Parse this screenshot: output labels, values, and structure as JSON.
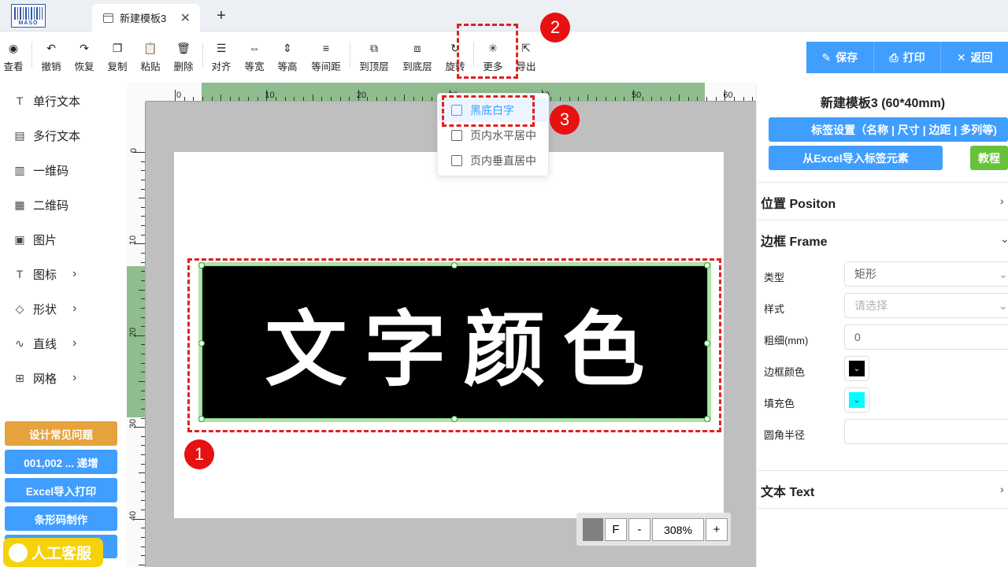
{
  "app": {
    "logo_text": "MASO"
  },
  "tabs": {
    "active_label": "新建模板3",
    "close_glyph": "✕",
    "new_glyph": "+"
  },
  "toolbar": [
    {
      "label": "查看",
      "icon": "eye-icon",
      "glyph": "◉"
    },
    {
      "label": "撤销",
      "icon": "undo-icon",
      "glyph": "↶"
    },
    {
      "label": "恢复",
      "icon": "redo-icon",
      "glyph": "↷"
    },
    {
      "label": "复制",
      "icon": "copy-icon",
      "glyph": "❐"
    },
    {
      "label": "粘贴",
      "icon": "paste-icon",
      "glyph": "📋"
    },
    {
      "label": "删除",
      "icon": "trash-icon",
      "glyph": "🗑"
    },
    {
      "label": "对齐",
      "icon": "align-icon",
      "glyph": "☰"
    },
    {
      "label": "等宽",
      "icon": "equal-width-icon",
      "glyph": "⇔"
    },
    {
      "label": "等高",
      "icon": "equal-height-icon",
      "glyph": "⇕"
    },
    {
      "label": "等间距",
      "icon": "equal-spacing-icon",
      "glyph": "≡"
    },
    {
      "label": "到顶层",
      "icon": "bring-to-front-icon",
      "glyph": "⧉"
    },
    {
      "label": "到底层",
      "icon": "send-to-back-icon",
      "glyph": "⧈"
    },
    {
      "label": "旋转",
      "icon": "rotate-icon",
      "glyph": "↻"
    },
    {
      "label": "更多",
      "icon": "more-icon",
      "glyph": "✳"
    },
    {
      "label": "导出",
      "icon": "export-icon",
      "glyph": "⇱"
    }
  ],
  "actions": {
    "save": "保存",
    "print": "打印",
    "back": "返回"
  },
  "sidebar": {
    "items": [
      {
        "label": "单行文本",
        "glyph": "T",
        "icon": "single-line-text-icon"
      },
      {
        "label": "多行文本",
        "glyph": "▤",
        "icon": "multi-line-text-icon"
      },
      {
        "label": "一维码",
        "glyph": "▥",
        "icon": "barcode-icon"
      },
      {
        "label": "二维码",
        "glyph": "▦",
        "icon": "qrcode-icon"
      },
      {
        "label": "图片",
        "glyph": "▣",
        "icon": "image-icon"
      },
      {
        "label": "图标",
        "glyph": "T",
        "icon": "icon-library-icon",
        "arrow": "›"
      },
      {
        "label": "形状",
        "glyph": "◇",
        "icon": "shape-icon",
        "arrow": "›"
      },
      {
        "label": "直线",
        "glyph": "∿",
        "icon": "line-icon",
        "arrow": "›"
      },
      {
        "label": "网格",
        "glyph": "⊞",
        "icon": "grid-icon",
        "arrow": "›"
      }
    ],
    "quick_buttons": [
      {
        "label": "设计常见问题",
        "color": "#e6a23c"
      },
      {
        "label": "001,002 ... 递增",
        "color": "#409eff"
      },
      {
        "label": "Excel导入打印",
        "color": "#409eff"
      },
      {
        "label": "条形码制作",
        "color": "#409eff"
      }
    ],
    "service": "人工客服"
  },
  "ruler": {
    "h_labels": [
      "0",
      "10",
      "20",
      "30",
      "40",
      "50",
      "60"
    ],
    "v_labels": [
      "0",
      "10",
      "20",
      "30",
      "40"
    ]
  },
  "canvas": {
    "label_text": "文字颜色",
    "label_bg": "#000000",
    "label_fg": "#ffffff"
  },
  "annotations": {
    "one": "1",
    "two": "2",
    "three": "3"
  },
  "more_menu": {
    "items": [
      {
        "label": "黑底白字",
        "icon": "black-bg-white-text-icon",
        "active": true
      },
      {
        "label": "页内水平居中",
        "icon": "center-horizontal-icon",
        "active": false
      },
      {
        "label": "页内垂直居中",
        "icon": "center-vertical-icon",
        "active": false
      }
    ]
  },
  "zoom": {
    "fit_label": "F",
    "minus": "-",
    "value": "308%",
    "plus": "+"
  },
  "right_panel": {
    "title": "新建模板3 (60*40mm)",
    "settings_button": "标签设置（名称 | 尺寸 | 边距 | 多列等)",
    "excel_button": "从Excel导入标签元素",
    "tutorial_button": "教程",
    "sections": {
      "position": "位置 Positon",
      "frame": "边框 Frame",
      "text": "文本 Text"
    },
    "frame": {
      "type_label": "类型",
      "type_value": "矩形",
      "style_label": "样式",
      "style_placeholder": "请选择",
      "width_label": "粗细(mm)",
      "width_value": "0",
      "border_color_label": "边框颜色",
      "border_color": "#000000",
      "fill_label": "填充色",
      "fill_color": "#00ffff",
      "radius_label": "圆角半径",
      "radius_value": ""
    }
  },
  "colors": {
    "primary": "#409eff",
    "warning": "#e6a23c",
    "success": "#67c23a",
    "annotation": "#e81010"
  }
}
